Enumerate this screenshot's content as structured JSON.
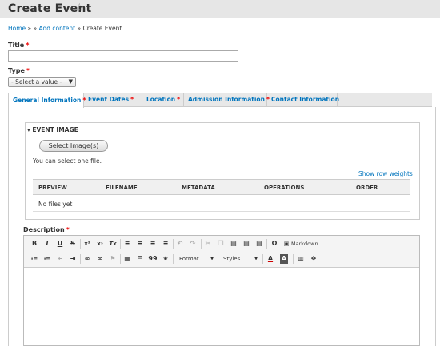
{
  "header": {
    "title": "Create Event"
  },
  "breadcrumb": {
    "home": "Home",
    "sep1": " » » ",
    "add_content": "Add content",
    "sep2": " » ",
    "current": "Create Event"
  },
  "title_field": {
    "label": "Title",
    "required": "*",
    "value": ""
  },
  "type_field": {
    "label": "Type",
    "required": "*",
    "selected": "- Select a value -"
  },
  "tabs": [
    {
      "label": "General Information",
      "required": "*"
    },
    {
      "label": "Event Dates",
      "required": "*"
    },
    {
      "label": "Location",
      "required": "*"
    },
    {
      "label": "Admission Information",
      "required": "*"
    },
    {
      "label": "Contact Information"
    }
  ],
  "event_image": {
    "legend": "▾ EVENT IMAGE",
    "select_button": "Select Image(s)",
    "help": "You can select one file.",
    "row_weights": "Show row weights",
    "columns": [
      "PREVIEW",
      "FILENAME",
      "METADATA",
      "OPERATIONS",
      "ORDER"
    ],
    "empty": "No files yet"
  },
  "description": {
    "label": "Description",
    "required": "*",
    "toolbar": {
      "bold": "B",
      "italic": "I",
      "underline": "U",
      "strike": "S",
      "superscript": "x²",
      "subscript": "x₂",
      "clear_format": "Tx",
      "omega": "Ω",
      "markdown": "Markdown",
      "format": "Format",
      "styles": "Styles",
      "text_color": "A",
      "bg_color": "A",
      "quote": "99",
      "star": "★"
    }
  }
}
